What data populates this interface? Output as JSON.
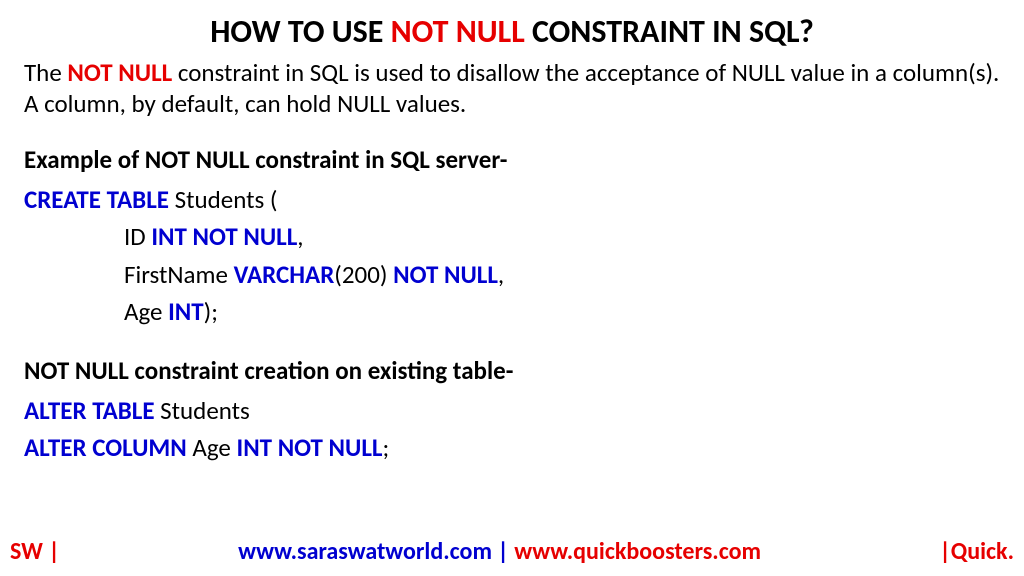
{
  "title": {
    "pre": "HOW TO USE ",
    "highlight": "NOT NULL",
    "post": " CONSTRAINT IN SQL?"
  },
  "description": {
    "pre": "The ",
    "highlight": "NOT NULL",
    "post": " constraint in SQL is used to disallow the acceptance of NULL value in a column(s). A column, by default, can hold NULL values."
  },
  "example1": {
    "heading": "Example of NOT NULL constraint in SQL server-",
    "line1_kw": "CREATE TABLE",
    "line1_rest": " Students (",
    "line2_col": "ID ",
    "line2_kw": "INT NOT NULL",
    "line2_post": ",",
    "line3_col": "FirstName ",
    "line3_kw1": "VARCHAR",
    "line3_paren": "(200) ",
    "line3_kw2": "NOT NULL",
    "line3_post": ",",
    "line4_col": "Age ",
    "line4_kw": "INT",
    "line4_post": ");"
  },
  "example2": {
    "heading": "NOT NULL constraint creation on existing table-",
    "line1_kw": "ALTER TABLE",
    "line1_rest": " Students",
    "line2_kw1": "ALTER COLUMN",
    "line2_mid": " Age ",
    "line2_kw2": "INT NOT NULL",
    "line2_post": ";"
  },
  "footer": {
    "left": "SW |",
    "center_blue": "www.saraswatworld.com | ",
    "center_red": "www.quickboosters.com",
    "right": "|Quick."
  }
}
